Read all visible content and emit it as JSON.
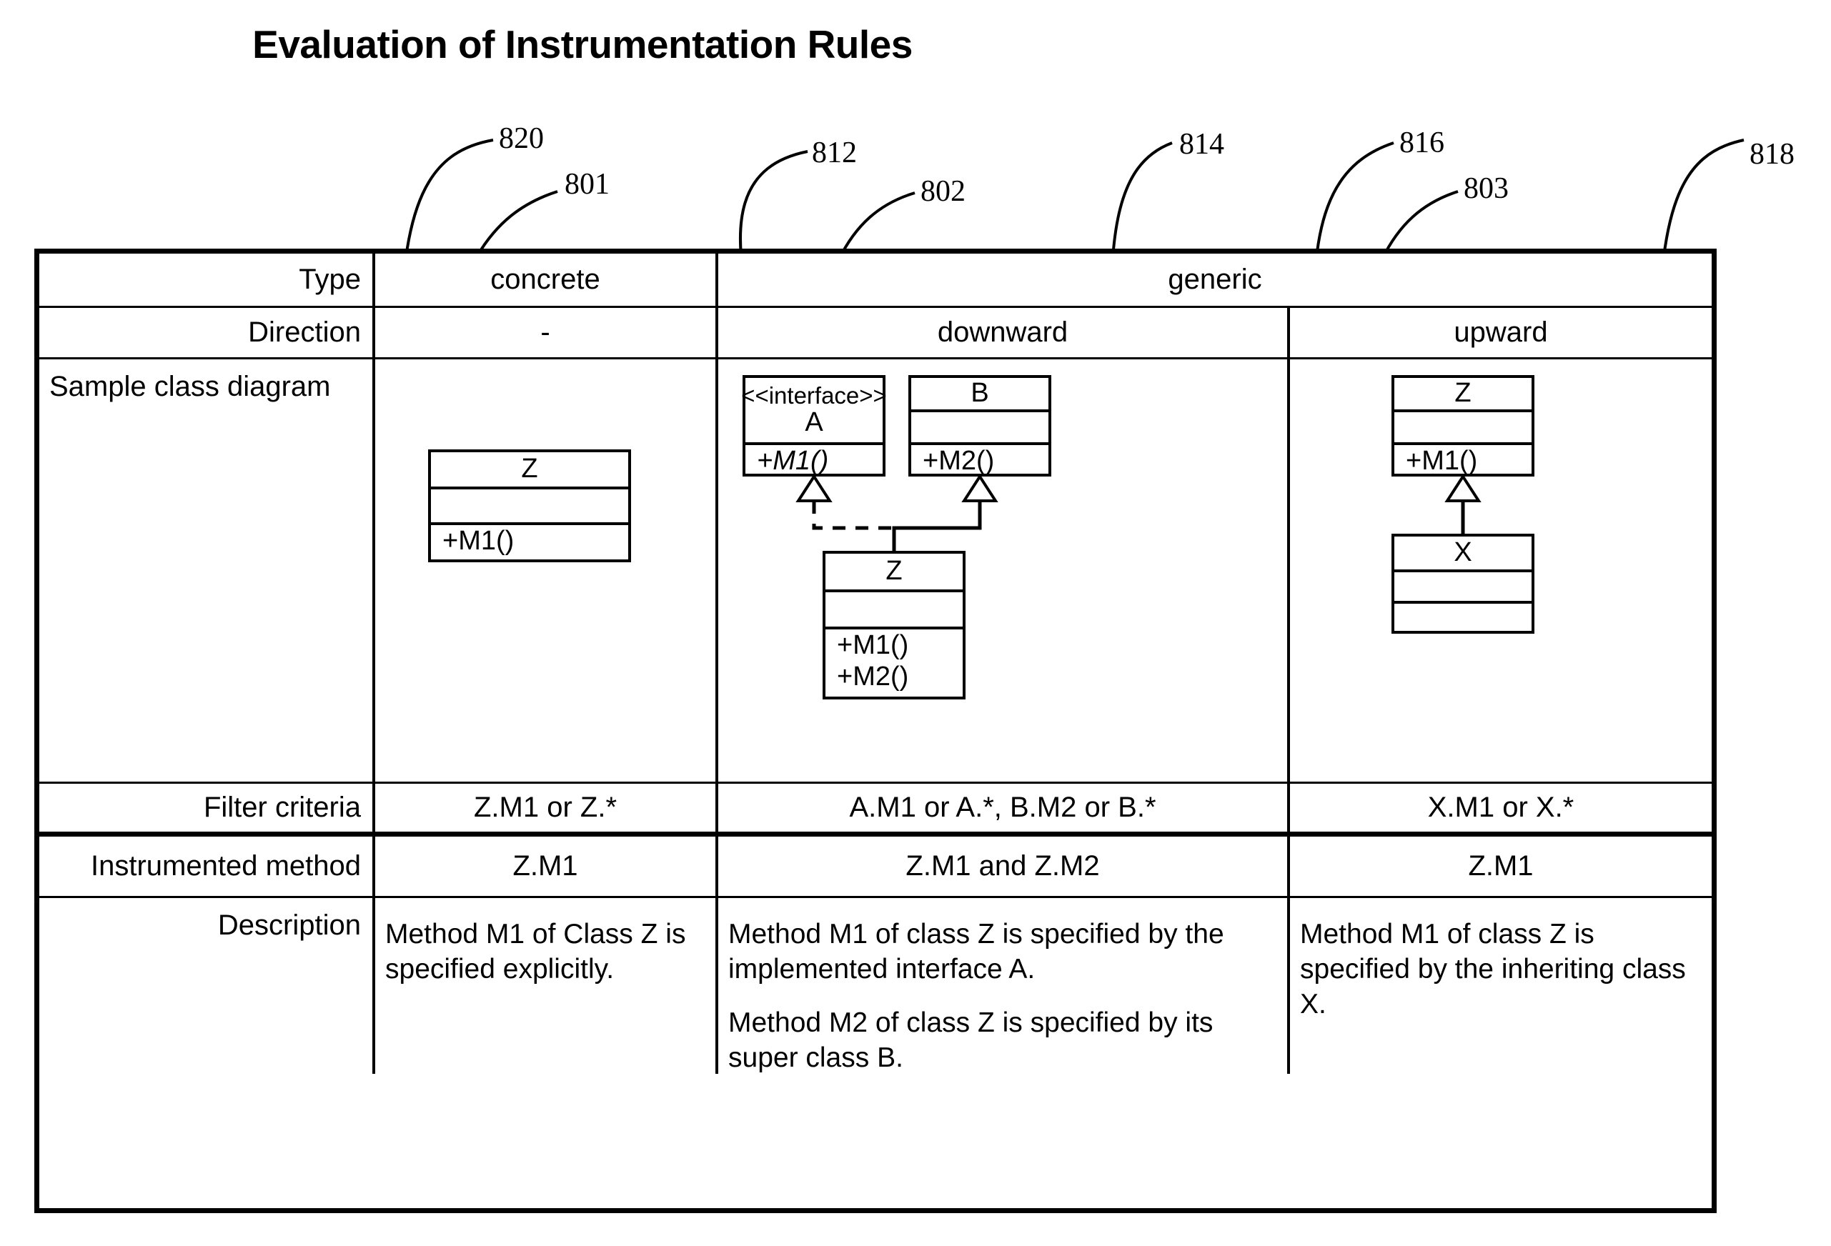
{
  "figure": {
    "title": "Evaluation of Instrumentation Rules"
  },
  "callouts": [
    {
      "id": "820",
      "label": "820"
    },
    {
      "id": "801",
      "label": "801"
    },
    {
      "id": "812",
      "label": "812"
    },
    {
      "id": "802",
      "label": "802"
    },
    {
      "id": "814",
      "label": "814"
    },
    {
      "id": "816",
      "label": "816"
    },
    {
      "id": "803",
      "label": "803"
    },
    {
      "id": "818",
      "label": "818"
    }
  ],
  "table": {
    "row_labels": {
      "type": "Type",
      "direction": "Direction",
      "sample_class_diagram": "Sample class diagram",
      "filter_criteria": "Filter criteria",
      "instrumented_method": "Instrumented method",
      "description": "Description"
    },
    "type_row": {
      "concrete": "concrete",
      "generic": "generic"
    },
    "direction_row": {
      "concrete": "-",
      "downward": "downward",
      "upward": "upward"
    },
    "filter_criteria_row": {
      "concrete": "Z.M1 or Z.*",
      "downward": "A.M1 or A.*, B.M2 or B.*",
      "upward": "X.M1 or X.*"
    },
    "instrumented_method_row": {
      "concrete": "Z.M1",
      "downward": "Z.M1 and Z.M2",
      "upward": "Z.M1"
    },
    "description_row": {
      "concrete": [
        "Method M1 of Class Z is specified explicitly."
      ],
      "downward": [
        "Method M1 of class Z is specified by the implemented interface A.",
        "Method M2 of class Z is specified by its super class B."
      ],
      "upward": [
        "Method M1 of class Z is specified by the inheriting class X."
      ]
    }
  },
  "diagrams": {
    "concrete": {
      "z_class": {
        "name": "Z",
        "attributes": "",
        "operations": "+M1()"
      }
    },
    "downward": {
      "interface_a": {
        "stereotype": "<<interface>>",
        "name": "A",
        "operations": "+M1()"
      },
      "class_b": {
        "name": "B",
        "attributes": "",
        "operations": "+M2()"
      },
      "class_z": {
        "name": "Z",
        "attributes": "",
        "operations_1": "+M1()",
        "operations_2": "+M2()"
      },
      "relations": [
        {
          "kind": "realization",
          "from": "Z",
          "to": "A",
          "line": "dashed",
          "arrow": "hollow-triangle"
        },
        {
          "kind": "generalization",
          "from": "Z",
          "to": "B",
          "line": "solid",
          "arrow": "hollow-triangle"
        }
      ]
    },
    "upward": {
      "class_z": {
        "name": "Z",
        "attributes": "",
        "operations": "+M1()"
      },
      "class_x": {
        "name": "X",
        "attributes": "",
        "operations": ""
      },
      "relations": [
        {
          "kind": "generalization",
          "from": "X",
          "to": "Z",
          "line": "solid",
          "arrow": "hollow-triangle"
        }
      ]
    }
  },
  "colors": {
    "ink": "#000000",
    "paper": "#ffffff"
  }
}
